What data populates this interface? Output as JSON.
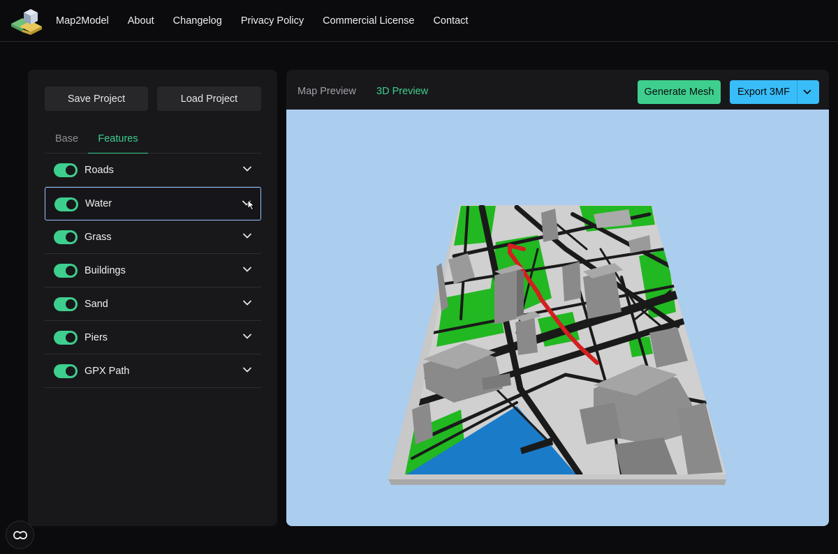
{
  "app": {
    "name": "Map2Model"
  },
  "nav": {
    "about": "About",
    "changelog": "Changelog",
    "privacy": "Privacy Policy",
    "license": "Commercial License",
    "contact": "Contact"
  },
  "sidebar": {
    "save_label": "Save Project",
    "load_label": "Load Project",
    "tabs": {
      "base": "Base",
      "features": "Features"
    },
    "features": [
      {
        "label": "Roads",
        "enabled": true
      },
      {
        "label": "Water",
        "enabled": true
      },
      {
        "label": "Grass",
        "enabled": true
      },
      {
        "label": "Buildings",
        "enabled": true
      },
      {
        "label": "Sand",
        "enabled": true
      },
      {
        "label": "Piers",
        "enabled": true
      },
      {
        "label": "GPX Path",
        "enabled": true
      }
    ]
  },
  "preview": {
    "tabs": {
      "map": "Map Preview",
      "three_d": "3D Preview"
    },
    "generate_label": "Generate Mesh",
    "export_label": "Export 3MF"
  },
  "colors": {
    "accent": "#3ecf8e",
    "export": "#38bdf8",
    "sky": "#abcdee",
    "water": "#1a7bc9",
    "grass": "#22b821",
    "gpx": "#d41f1f"
  }
}
